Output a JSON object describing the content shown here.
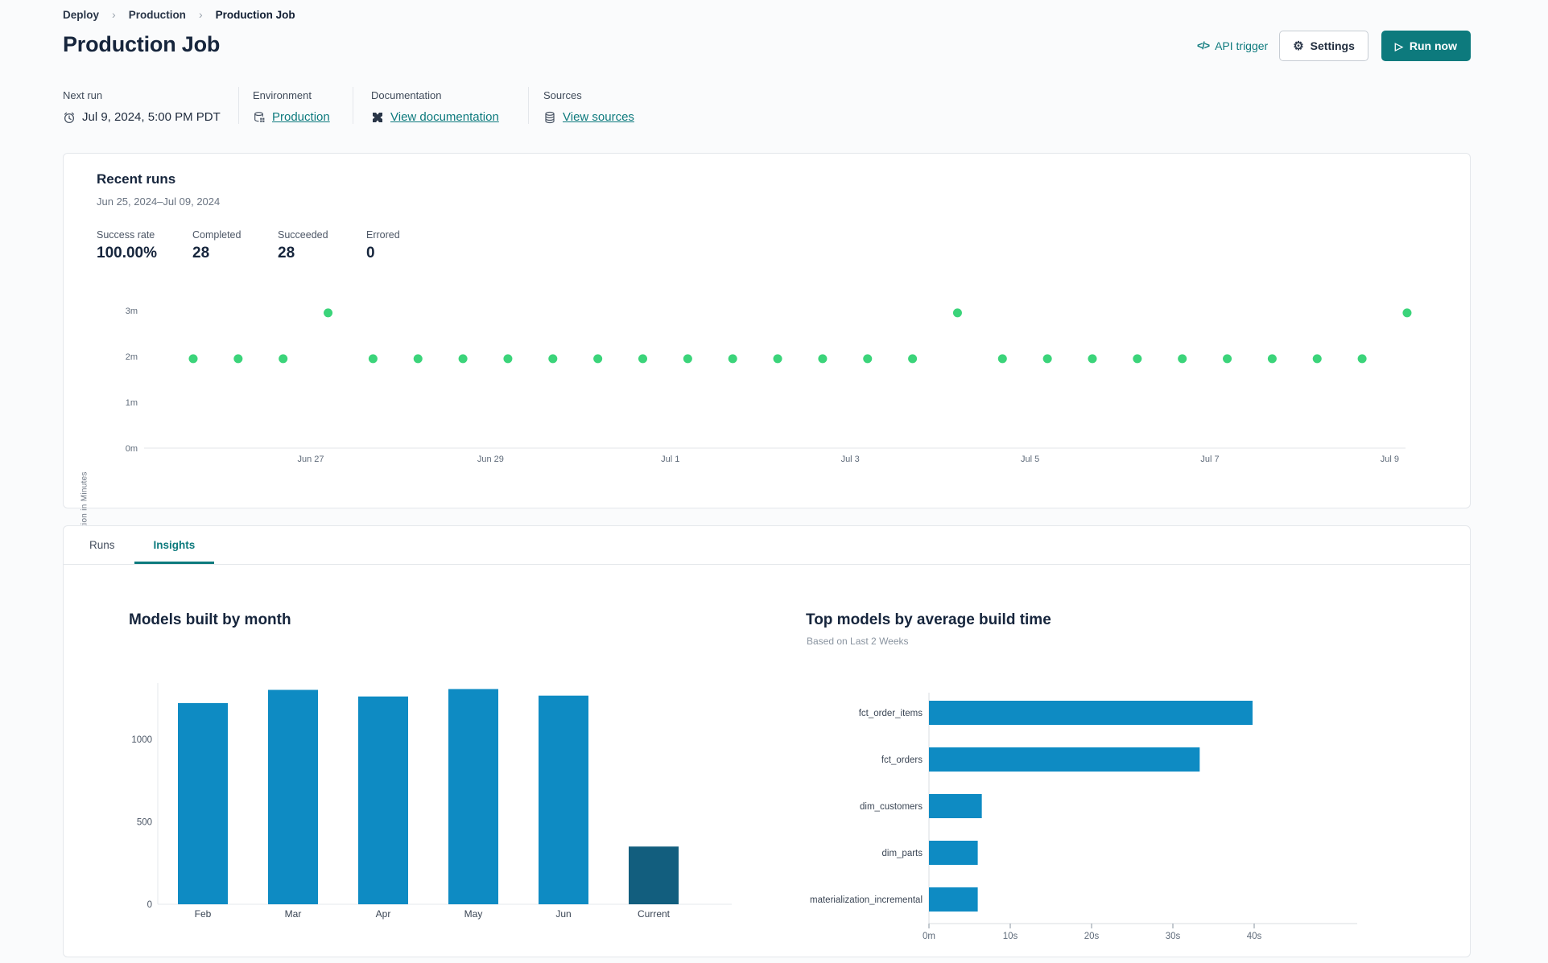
{
  "colors": {
    "accent": "#0d7a7d",
    "bar_blue": "#0e8bc3",
    "bar_highlight": "#125e7e",
    "run_point_green": "#3bd47a",
    "card_border": "#e4e7eb"
  },
  "breadcrumb": {
    "items": [
      "Deploy",
      "Production",
      "Production Job"
    ]
  },
  "header": {
    "title": "Production Job",
    "api_trigger_label": "API trigger",
    "api_trigger_icon": "</>",
    "settings_label": "Settings",
    "run_now_label": "Run now"
  },
  "meta": {
    "next_run": {
      "label": "Next run",
      "value": "Jul 9, 2024, 5:00 PM PDT"
    },
    "environment": {
      "label": "Environment",
      "value": "Production"
    },
    "documentation": {
      "label": "Documentation",
      "value": "View documentation"
    },
    "sources": {
      "label": "Sources",
      "value": "View sources"
    }
  },
  "recent_runs": {
    "title": "Recent runs",
    "date_range": "Jun 25, 2024–Jul 09, 2024",
    "stats": [
      {
        "label": "Success rate",
        "value": "100.00%"
      },
      {
        "label": "Completed",
        "value": "28"
      },
      {
        "label": "Succeeded",
        "value": "28"
      },
      {
        "label": "Errored",
        "value": "0"
      }
    ]
  },
  "tabs": [
    {
      "label": "Runs",
      "active": false
    },
    {
      "label": "Insights",
      "active": true
    }
  ],
  "chart_data": [
    {
      "id": "build-duration-scatter",
      "type": "scatter",
      "ylabel": "Build Duration in Minutes",
      "yticks": [
        "0m",
        "1m",
        "2m",
        "3m"
      ],
      "ylim_minutes": [
        0,
        3.2
      ],
      "xticks": [
        "Jun 27",
        "Jun 29",
        "Jul 1",
        "Jul 3",
        "Jul 5",
        "Jul 7",
        "Jul 9"
      ],
      "runs_per_day": 2,
      "point_color": "#3bd47a",
      "durations_minutes": [
        1.95,
        1.95,
        1.95,
        2.95,
        1.95,
        1.95,
        1.95,
        1.95,
        1.95,
        1.95,
        1.95,
        1.95,
        1.95,
        1.95,
        1.95,
        1.95,
        1.95,
        2.95,
        1.95,
        1.95,
        1.95,
        1.95,
        1.95,
        1.95,
        1.95,
        1.95,
        1.95,
        2.95
      ]
    },
    {
      "id": "models-built-by-month",
      "type": "bar",
      "title": "Models built by month",
      "categories": [
        "Feb",
        "Mar",
        "Apr",
        "May",
        "Jun",
        "Current"
      ],
      "values": [
        1220,
        1300,
        1260,
        1305,
        1265,
        350
      ],
      "yticks": [
        0,
        500,
        1000
      ],
      "ylim": [
        0,
        1390
      ],
      "bar_color": "#0e8bc3",
      "highlight_color": "#125e7e",
      "highlight_index": 5
    },
    {
      "id": "top-models-by-avg-build-time",
      "type": "bar_horizontal",
      "title": "Top models by average build time",
      "subtitle": "Based on Last 2 Weeks",
      "categories": [
        "fct_order_items",
        "fct_orders",
        "dim_customers",
        "dim_parts",
        "materialization_incremental"
      ],
      "values_seconds": [
        39.8,
        33.3,
        6.5,
        6.0,
        6.0
      ],
      "xticks": [
        "0m",
        "10s",
        "20s",
        "30s",
        "40s"
      ],
      "xlim_seconds": [
        0,
        44
      ],
      "bar_color": "#0e8bc3"
    }
  ]
}
